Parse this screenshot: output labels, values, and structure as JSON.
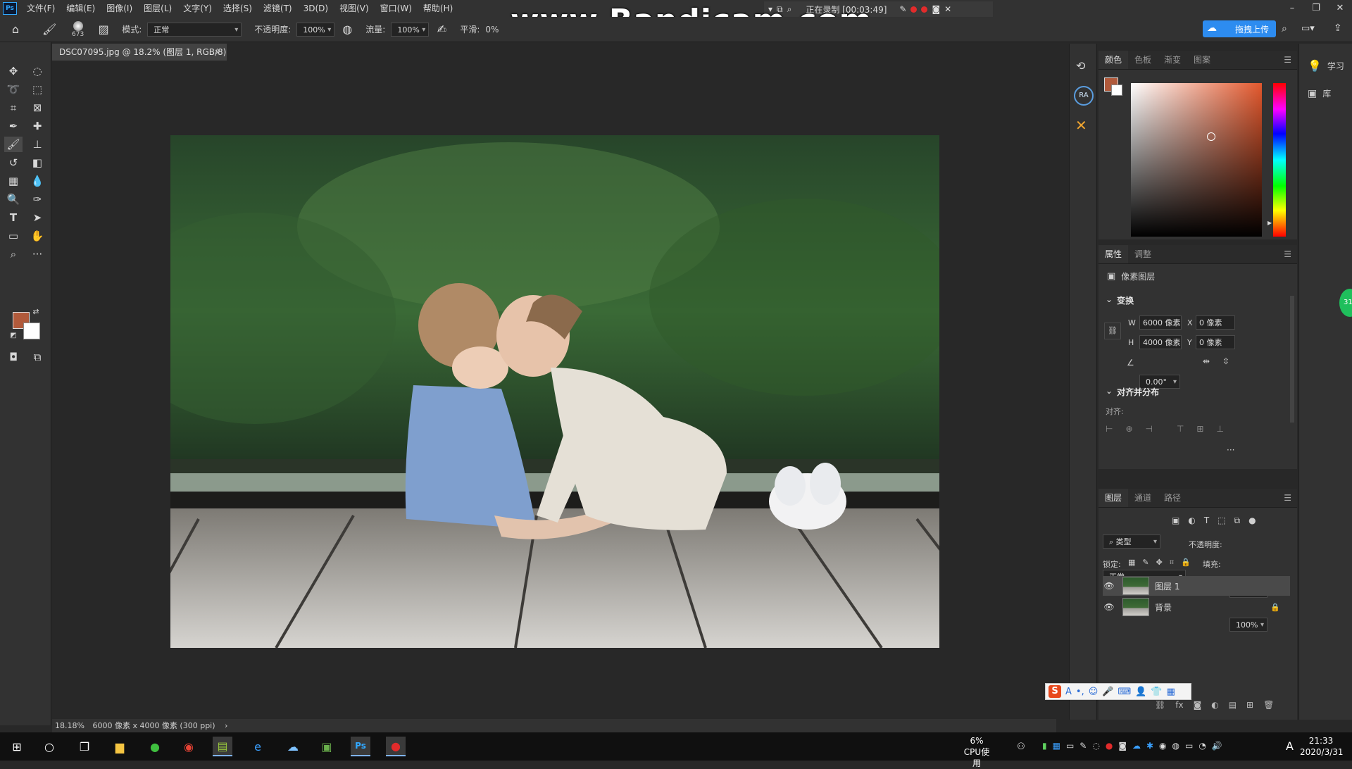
{
  "menubar": {
    "items": [
      "文件(F)",
      "编辑(E)",
      "图像(I)",
      "图层(L)",
      "文字(Y)",
      "选择(S)",
      "滤镜(T)",
      "3D(D)",
      "视图(V)",
      "窗口(W)",
      "帮助(H)"
    ],
    "app_logo": "Ps"
  },
  "recorder": {
    "status": "正在录制 [00:03:49]",
    "watermark": "www.Bandicam.com"
  },
  "options": {
    "brush_size": "673",
    "mode_label": "模式:",
    "mode_value": "正常",
    "opacity_label": "不透明度:",
    "opacity_value": "100%",
    "flow_label": "流量:",
    "flow_value": "100%",
    "smoothing_label": "平滑:",
    "smoothing_value": "0%",
    "upload_label": "拖拽上传"
  },
  "document": {
    "tab_title": "DSC07095.jpg @ 18.2% (图层 1, RGB/8) *",
    "tab_close": "×",
    "status_zoom": "18.18%",
    "status_info": "6000 像素 x 4000 像素 (300 ppi)",
    "status_arrow": "›"
  },
  "far_strip": {
    "learn_label": "学习",
    "library_label": "库"
  },
  "icon_strip": {
    "ra_label": "RA"
  },
  "color_panel": {
    "tabs": [
      "颜色",
      "色板",
      "渐变",
      "图案"
    ],
    "foreground": "#b15a3b",
    "background": "#ffffff"
  },
  "properties_panel": {
    "tabs": [
      "属性",
      "调整"
    ],
    "layer_type": "像素图层",
    "transform_title": "变换",
    "w_label": "W",
    "w_value": "6000 像素",
    "h_label": "H",
    "h_value": "4000 像素",
    "x_label": "X",
    "x_value": "0 像素",
    "y_label": "Y",
    "y_value": "0 像素",
    "angle_value": "0.00°",
    "align_title": "对齐并分布",
    "align_label": "对齐:",
    "more": "···"
  },
  "layers_panel": {
    "tabs": [
      "图层",
      "通道",
      "路径"
    ],
    "filter_label": "类型",
    "blend_mode": "正常",
    "opacity_label": "不透明度:",
    "opacity_value": "100%",
    "lock_label": "锁定:",
    "fill_label": "填充:",
    "fill_value": "100%",
    "layers": [
      {
        "name": "图层 1",
        "selected": true,
        "locked": false
      },
      {
        "name": "背景",
        "selected": false,
        "locked": true
      }
    ]
  },
  "taskbar": {
    "cpu_value": "6%",
    "cpu_label": "CPU使用",
    "time": "21:33",
    "date": "2020/3/31",
    "ime_char": "A",
    "green_badge": "31"
  },
  "colors": {
    "accent": "#2d8cf0",
    "ui_bg": "#323232",
    "canvas_bg": "#282828"
  }
}
